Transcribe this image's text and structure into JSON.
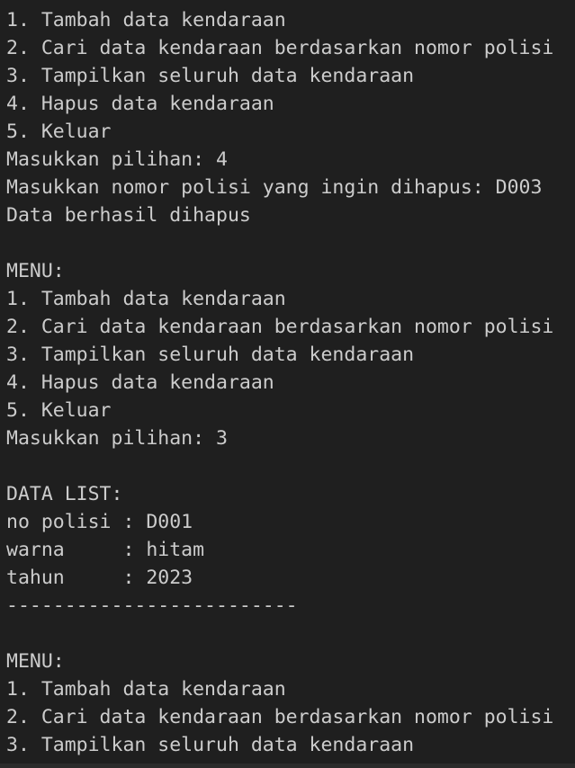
{
  "terminal": {
    "lines": [
      "1. Tambah data kendaraan",
      "2. Cari data kendaraan berdasarkan nomor polisi",
      "3. Tampilkan seluruh data kendaraan",
      "4. Hapus data kendaraan",
      "5. Keluar",
      "Masukkan pilihan: 4",
      "Masukkan nomor polisi yang ingin dihapus: D003",
      "Data berhasil dihapus",
      "",
      "MENU:",
      "1. Tambah data kendaraan",
      "2. Cari data kendaraan berdasarkan nomor polisi",
      "3. Tampilkan seluruh data kendaraan",
      "4. Hapus data kendaraan",
      "5. Keluar",
      "Masukkan pilihan: 3",
      "",
      "DATA LIST:",
      "no polisi : D001",
      "warna     : hitam",
      "tahun     : 2023",
      "-------------------------",
      "",
      "MENU:",
      "1. Tambah data kendaraan",
      "2. Cari data kendaraan berdasarkan nomor polisi",
      "3. Tampilkan seluruh data kendaraan"
    ]
  },
  "colors": {
    "background": "#1f1f1f",
    "text": "#cccccc"
  }
}
